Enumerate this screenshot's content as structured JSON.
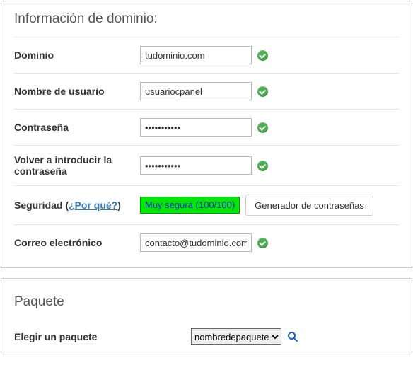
{
  "domain_info": {
    "title": "Información de dominio:",
    "fields": {
      "domain_label": "Dominio",
      "domain_value": "tudominio.com",
      "username_label": "Nombre de usuario",
      "username_value": "usuariocpanel",
      "password_label": "Contraseña",
      "password_value": "•••••••••••",
      "password2_label": "Volver a introducir la contraseña",
      "password2_value": "•••••••••••",
      "security_label_pre": "Seguridad (",
      "security_link": "¿Por qué?",
      "security_label_post": ")",
      "strength_text": "Muy segura (100/100)",
      "generator_btn": "Generador de contraseñas",
      "email_label": "Correo electrónico",
      "email_value": "contacto@tudominio.com"
    }
  },
  "package": {
    "title": "Paquete",
    "choose_label": "Elegir un paquete",
    "selected": "nombredepaquete"
  }
}
